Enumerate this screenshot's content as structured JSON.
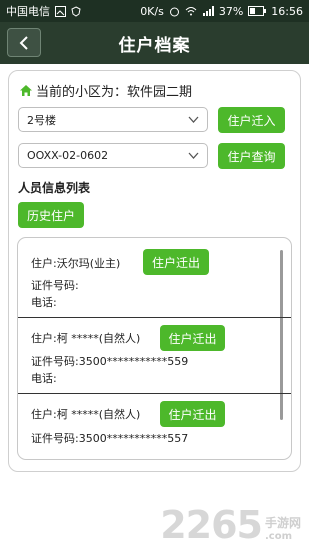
{
  "status_bar": {
    "carrier": "中国电信",
    "speed": "0K/s",
    "battery": "37%",
    "time": "16:56"
  },
  "header": {
    "back_icon": "chevron-left-icon",
    "title": "住户档案"
  },
  "community": {
    "label": "当前的小区为：软件园二期"
  },
  "building_select": {
    "value": "2号楼"
  },
  "move_in_button": "住户迁入",
  "room_select": {
    "value": "OOXX-02-0602"
  },
  "query_button": "住户查询",
  "list_title": "人员信息列表",
  "history_button": "历史住户",
  "residents": [
    {
      "name_line": "住户:沃尔玛(业主)",
      "id_line": "证件号码:",
      "phone_line": "电话:",
      "action": "住户迁出"
    },
    {
      "name_line": "住户:柯 *****(自然人)",
      "id_line": "证件号码:3500***********559",
      "phone_line": "电话:",
      "action": "住户迁出"
    },
    {
      "name_line": "住户:柯 *****(自然人)",
      "id_line": "证件号码:3500***********557",
      "phone_line": "",
      "action": "住户迁出"
    }
  ],
  "watermark": {
    "number": "2265",
    "sub": "手游网",
    "domain": ".com"
  },
  "colors": {
    "accent_green": "#4db82b",
    "titlebar": "#2a3d2e"
  }
}
